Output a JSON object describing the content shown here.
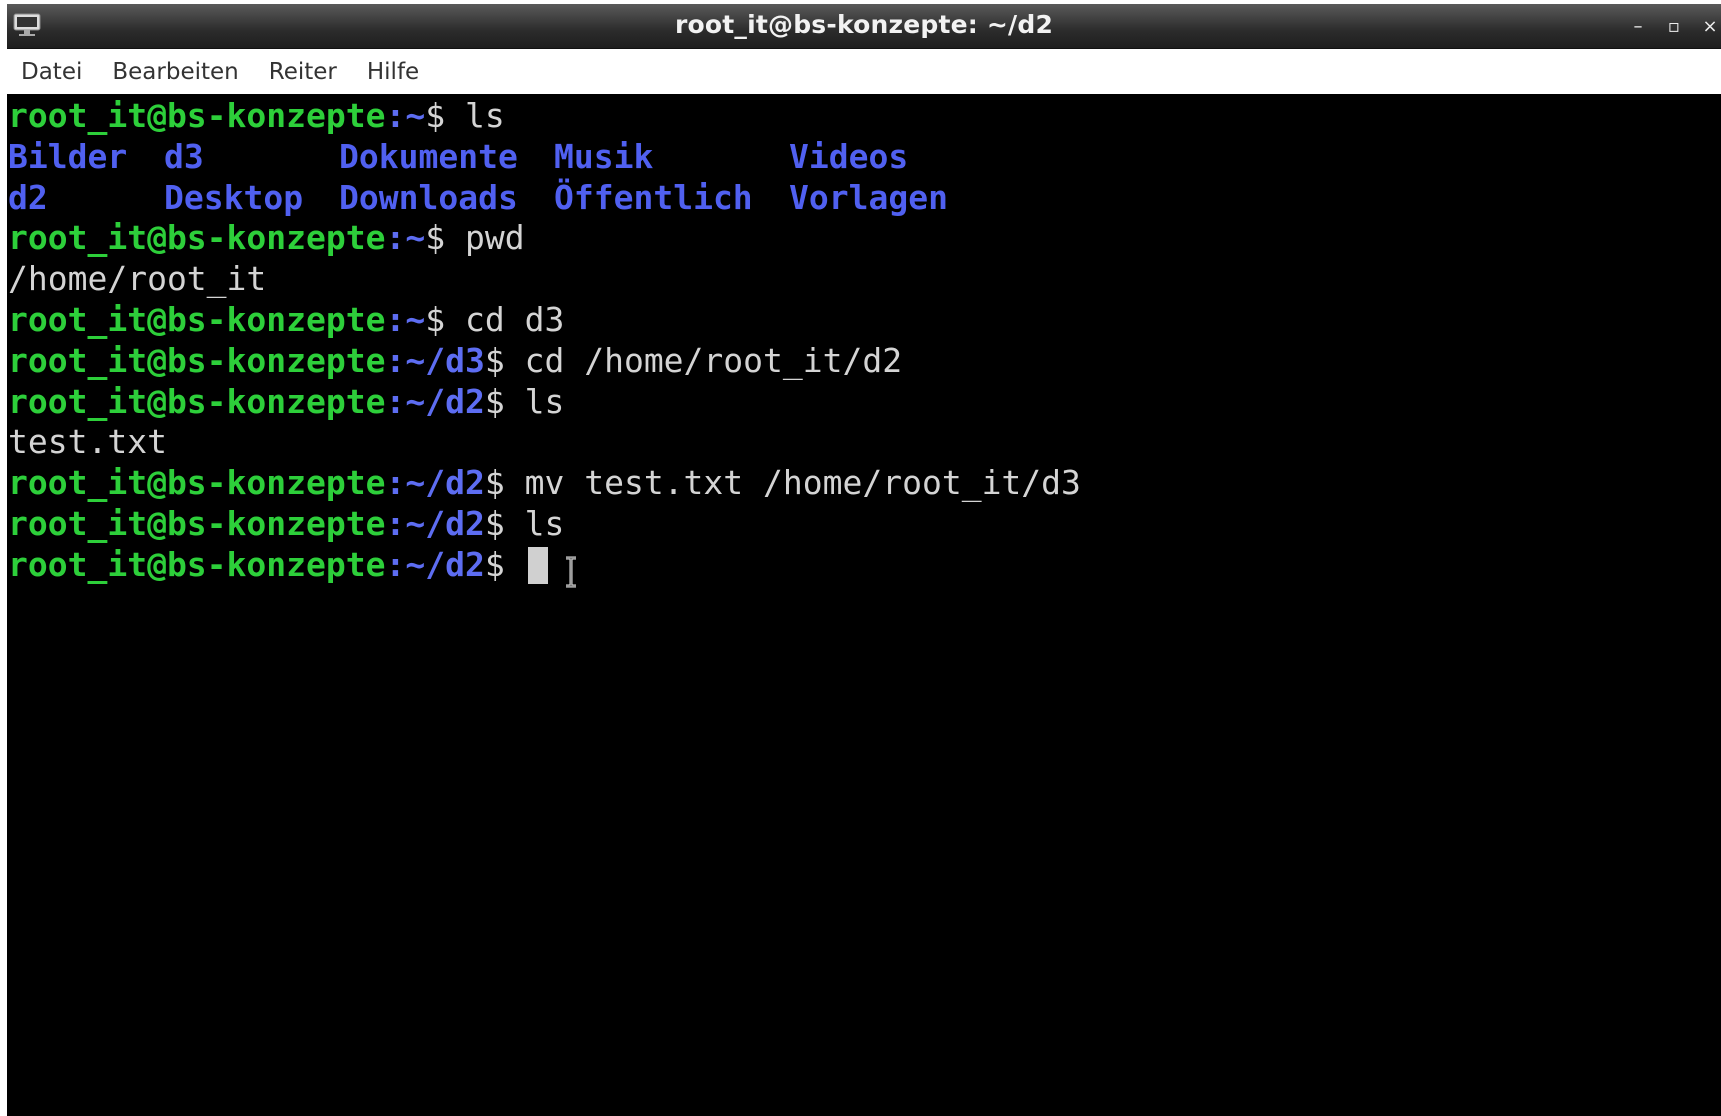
{
  "window": {
    "title": "root_it@bs-konzepte: ~/d2",
    "controls": {
      "minimize": "–",
      "maximize": "▫",
      "close": "×"
    }
  },
  "menu": {
    "items": [
      "Datei",
      "Bearbeiten",
      "Reiter",
      "Hilfe"
    ]
  },
  "terminal": {
    "prompt_user": "root_it@bs-konzepte",
    "lines": [
      {
        "type": "prompt",
        "path": "~",
        "command": "ls"
      },
      {
        "type": "ls",
        "row": [
          "Bilder",
          "d3",
          "Dokumente",
          "Musik",
          "Videos"
        ]
      },
      {
        "type": "ls",
        "row": [
          "d2",
          "Desktop",
          "Downloads",
          "Öffentlich",
          "Vorlagen"
        ]
      },
      {
        "type": "prompt",
        "path": "~",
        "command": "pwd"
      },
      {
        "type": "output",
        "text": "/home/root_it"
      },
      {
        "type": "prompt",
        "path": "~",
        "command": "cd d3"
      },
      {
        "type": "prompt",
        "path": "~/d3",
        "command": "cd /home/root_it/d2"
      },
      {
        "type": "prompt",
        "path": "~/d2",
        "command": "ls"
      },
      {
        "type": "output",
        "text": "test.txt"
      },
      {
        "type": "prompt",
        "path": "~/d2",
        "command": "mv test.txt /home/root_it/d3"
      },
      {
        "type": "prompt",
        "path": "~/d2",
        "command": "ls"
      },
      {
        "type": "prompt",
        "path": "~/d2",
        "command": "",
        "cursor": true
      }
    ]
  },
  "colors": {
    "prompt_user": "#2dcf3a",
    "prompt_path": "#5d6df2",
    "directory": "#5060f0",
    "text": "#d4d4d4",
    "background": "#000000"
  },
  "icons": {
    "app": "terminal-icon",
    "pointer": "i-beam-cursor-icon"
  }
}
